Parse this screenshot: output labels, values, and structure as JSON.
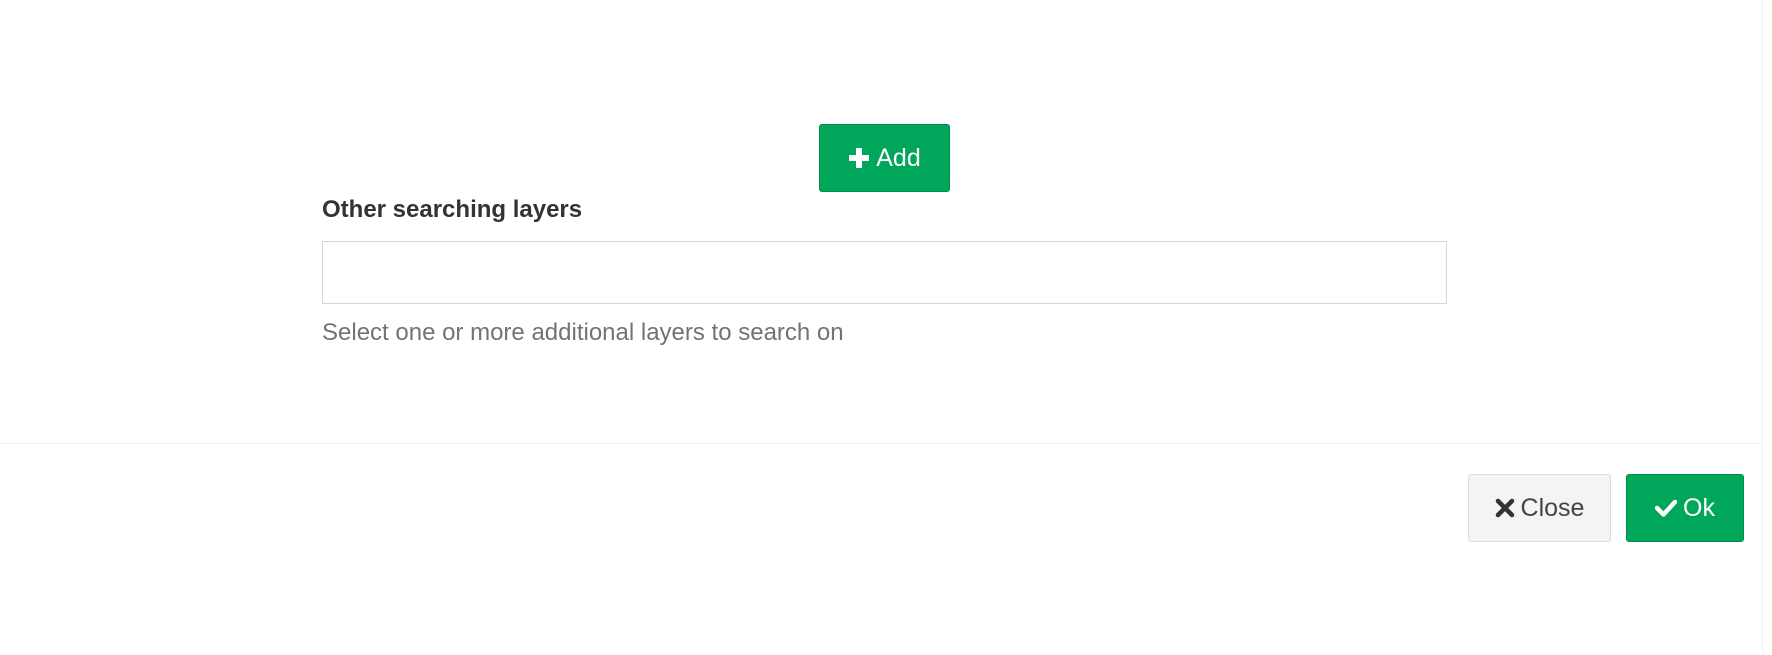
{
  "form": {
    "add_button": {
      "label": "Add",
      "icon": "plus-icon"
    },
    "other_layers": {
      "label": "Other searching layers",
      "value": "",
      "help": "Select one or more additional layers to search on"
    }
  },
  "footer": {
    "close_button": {
      "label": "Close",
      "icon": "times-icon"
    },
    "ok_button": {
      "label": "Ok",
      "icon": "check-icon"
    }
  },
  "colors": {
    "success": "#00a65a",
    "default_button": "#f4f4f4",
    "label_text": "#333333",
    "help_text": "#737373"
  }
}
